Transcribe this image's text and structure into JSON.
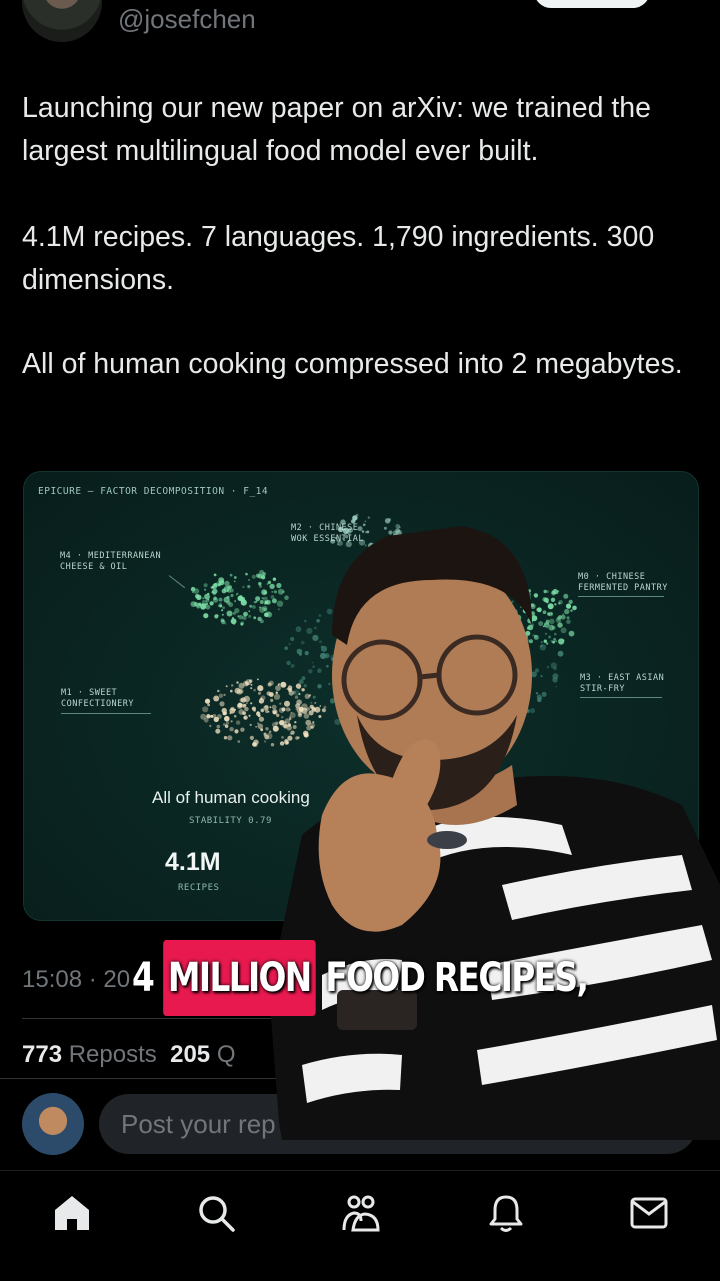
{
  "header": {
    "handle": "@josefchen"
  },
  "tweet": {
    "paragraphs": [
      "Launching our new paper on arXiv: we trained the largest multilingual food model ever built.",
      "4.1M recipes. 7 languages. 1,790 ingredients. 300 dimensions.",
      "All of human cooking compressed into 2 megabytes."
    ]
  },
  "card": {
    "heading": "EPICURE — FACTOR DECOMPOSITION · F_14",
    "clusters": [
      {
        "label": "M2 · CHINESE\nWOK ESSENTIAL"
      },
      {
        "label": "M4 · MEDITERRANEAN\nCHEESE & OIL"
      },
      {
        "label": "M0 · CHINESE\nFERMENTED PANTRY"
      },
      {
        "label": "M1 · SWEET\nCONFECTIONERY"
      },
      {
        "label": "M3 · EAST ASIAN\nSTIR-FRY"
      }
    ],
    "caption": "All of human cooking",
    "stability": "STABILITY 0.79",
    "big_number": "4.1M",
    "big_label": "RECIPES"
  },
  "meta": {
    "timestamp": "15:08 · 20",
    "reposts_count": "773",
    "reposts_label": "Reposts",
    "quotes_count": "205",
    "quotes_label": "Q"
  },
  "reply": {
    "placeholder": "Post your rep"
  },
  "subtitle": {
    "lead": "4",
    "highlight": "MILLION",
    "rest": "FOOD RECIPES,"
  },
  "nav": {
    "items": [
      "home-icon",
      "search-icon",
      "communities-icon",
      "notifications-icon",
      "messages-icon"
    ]
  },
  "colors": {
    "accent_highlight": "#e8194f",
    "card_bg": "#0a2522",
    "cluster_green": "#7ee0a8",
    "cluster_cream": "#f1e1c0"
  }
}
